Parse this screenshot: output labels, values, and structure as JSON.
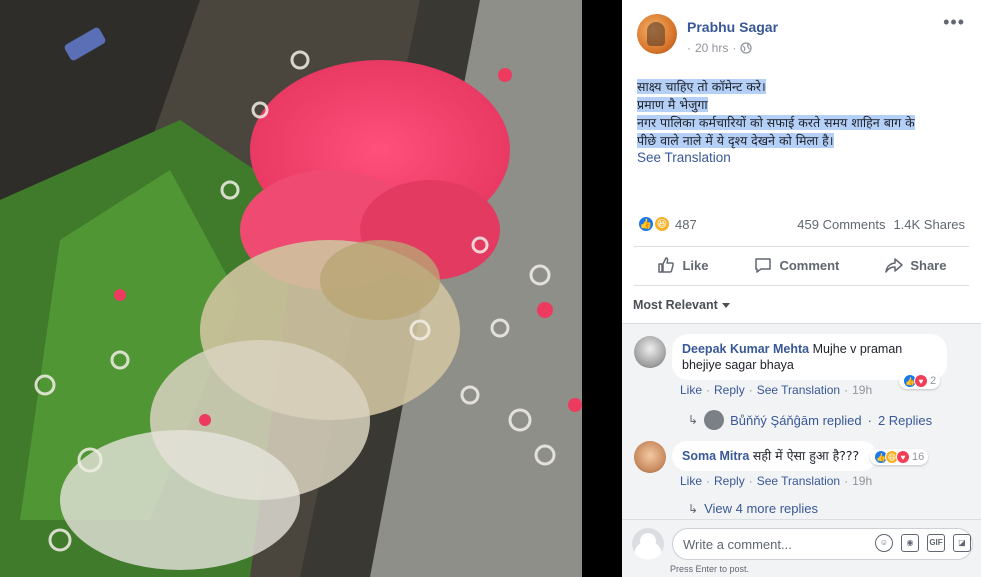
{
  "post": {
    "author": "Prabhu Sagar",
    "time": "20 hrs",
    "text_lines": [
      "साक्ष्य चाहिए तो कॉमेन्ट करे।",
      "प्रमाण मै भेजुगा",
      "नगर पालिका कर्मचारियों को सफाई करते समय शाहिन बाग के",
      "पीछे वाले नाले में ये दृश्य देखने को मिला है।"
    ],
    "see_translation": "See Translation",
    "reaction_count": "487",
    "comments_count": "459 Comments",
    "shares_count": "1.4K Shares"
  },
  "actions": {
    "like": "Like",
    "comment": "Comment",
    "share": "Share"
  },
  "sort": {
    "label": "Most Relevant"
  },
  "comments": [
    {
      "name": "Deepak Kumar Mehta",
      "text": "Mujhe v praman bhejiye sagar bhaya",
      "like": "Like",
      "reply": "Reply",
      "see_translation": "See Translation",
      "time": "19h",
      "reactions": "2",
      "reply_summary": {
        "name": "Bůňňý Şáňĝām replied",
        "count": "2 Replies"
      }
    },
    {
      "name": "Soma Mitra",
      "text": "सही में ऐसा हुआ है???",
      "like": "Like",
      "reply": "Reply",
      "see_translation": "See Translation",
      "time": "19h",
      "reactions": "16",
      "more_replies": "View 4 more replies"
    }
  ],
  "composer": {
    "placeholder": "Write a comment...",
    "hint": "Press Enter to post."
  },
  "colors": {
    "link": "#385898",
    "highlight": "#b4d0f7",
    "like_blue": "#1877f2"
  }
}
